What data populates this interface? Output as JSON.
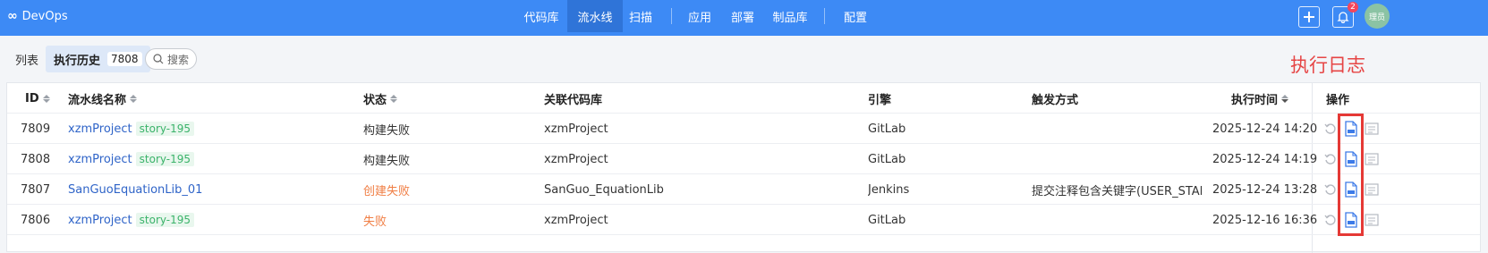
{
  "header": {
    "brand": "DevOps",
    "brand_symbol": "∞",
    "nav_items": [
      {
        "label": "代码库"
      },
      {
        "label": "流水线"
      },
      {
        "label": "扫描"
      },
      {
        "label": "应用"
      },
      {
        "label": "部署"
      },
      {
        "label": "制品库"
      },
      {
        "label": "配置"
      }
    ],
    "active_nav": "流水线",
    "notification_count": "2",
    "avatar_text": "理员"
  },
  "toolbar": {
    "tab_list": "列表",
    "tab_history": "执行历史",
    "history_count": "7808",
    "search_label": "搜索"
  },
  "annotation": "执行日志",
  "table": {
    "columns": [
      "ID",
      "流水线名称",
      "状态",
      "关联代码库",
      "引擎",
      "触发方式",
      "执行时间",
      "操作"
    ],
    "rows": [
      {
        "id": "7809",
        "name": "xzmProject",
        "tag": "story-195",
        "status": "构建失败",
        "status_color": "normal",
        "repo": "xzmProject",
        "engine": "GitLab",
        "trigger": "",
        "time": "2025-12-24 14:20"
      },
      {
        "id": "7808",
        "name": "xzmProject",
        "tag": "story-195",
        "status": "构建失败",
        "status_color": "normal",
        "repo": "xzmProject",
        "engine": "GitLab",
        "trigger": "",
        "time": "2025-12-24 14:19"
      },
      {
        "id": "7807",
        "name": "SanGuoEquationLib_01",
        "tag": "",
        "status": "创建失败",
        "status_color": "warning",
        "repo": "SanGuo_EquationLib",
        "engine": "Jenkins",
        "trigger": "提交注释包含关键字(USER_START",
        "time": "2025-12-24 13:28"
      },
      {
        "id": "7806",
        "name": "xzmProject",
        "tag": "story-195",
        "status": "失败",
        "status_color": "warning",
        "repo": "xzmProject",
        "engine": "GitLab",
        "trigger": "",
        "time": "2025-12-16 16:36"
      }
    ],
    "row_icons": [
      "retry-icon",
      "log-icon",
      "detail-icon"
    ]
  },
  "colors": {
    "topbar": "#3d8af5",
    "active_nav": "#2f74d8",
    "link": "#2f64c8",
    "tag_text": "#3bb36a",
    "warning": "#f07e44",
    "annotation": "#e64545",
    "highlight": "#e53935"
  }
}
